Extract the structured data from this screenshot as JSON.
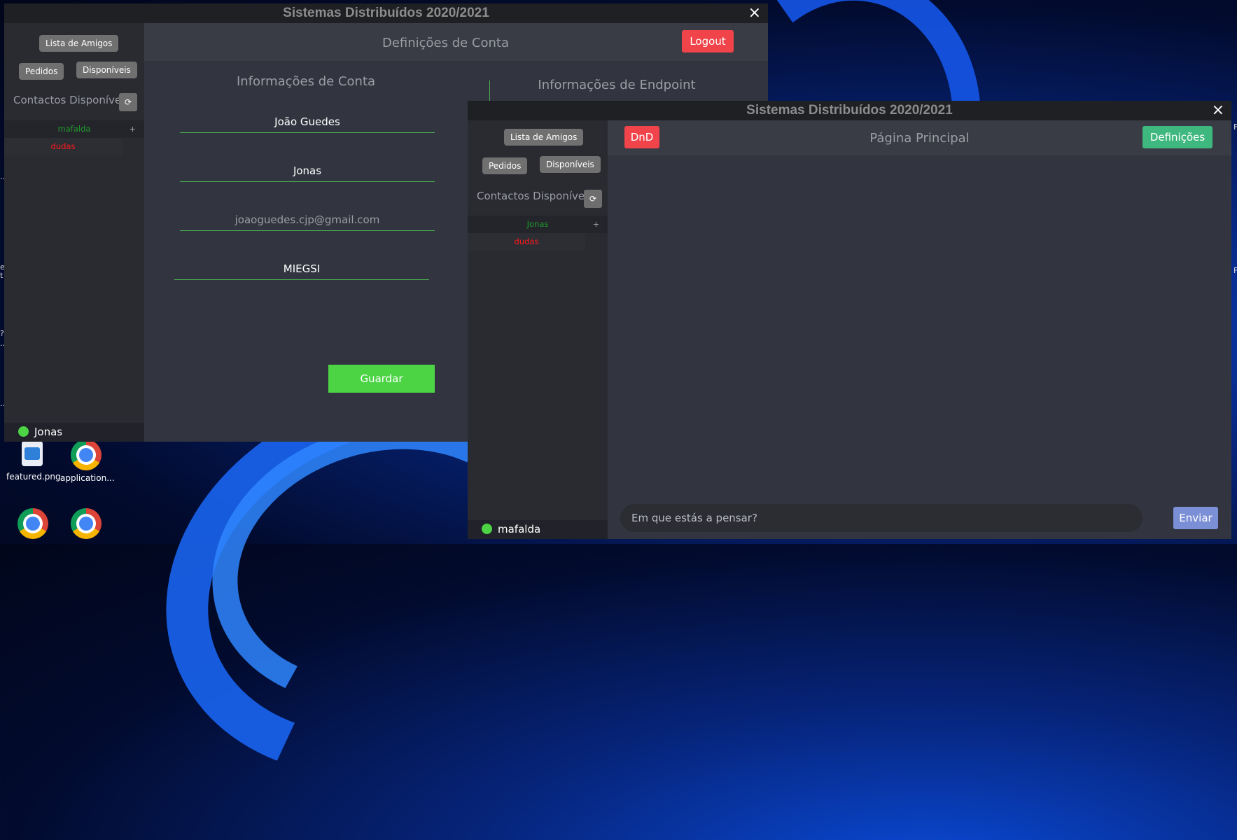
{
  "desktop": {
    "icons": [
      {
        "label": "featured.png",
        "kind": "image"
      },
      {
        "label": "application...",
        "kind": "chrome"
      },
      {
        "label": "",
        "kind": "chrome"
      },
      {
        "label": "",
        "kind": "chrome"
      }
    ]
  },
  "window_settings": {
    "title": "Sistemas Distribuídos 2020/2021",
    "close_icon": "×",
    "sidebar": {
      "friends_list": "Lista de Amigos",
      "requests": "Pedidos",
      "available": "Disponíveis",
      "contacts_title": "Contactos Disponíveis",
      "refresh_icon": "⟳",
      "contacts": [
        {
          "name": "mafalda",
          "color": "#1f9a2a",
          "action": "+"
        },
        {
          "name": "dudas",
          "color": "#ff1a1a",
          "action": ""
        }
      ],
      "status_user": "Jonas"
    },
    "header": {
      "title": "Definições de Conta",
      "logout": "Logout"
    },
    "account_section": {
      "title": "Informações de Conta",
      "name": "João Guedes",
      "username": "Jonas",
      "email_placeholder": "joaoguedes.cjp@gmail.com",
      "course": "MIEGSI",
      "save": "Guardar"
    },
    "endpoint_section": {
      "title": "Informações de Endpoint"
    }
  },
  "window_main": {
    "title": "Sistemas Distribuídos 2020/2021",
    "close_icon": "×",
    "sidebar": {
      "friends_list": "Lista de Amigos",
      "requests": "Pedidos",
      "available": "Disponíveis",
      "contacts_title": "Contactos Disponíveis",
      "refresh_icon": "⟳",
      "contacts": [
        {
          "name": "Jonas",
          "color": "#1f9a2a",
          "action": "+"
        },
        {
          "name": "dudas",
          "color": "#ff1a1a",
          "action": ""
        }
      ],
      "status_user": "mafalda"
    },
    "header": {
      "dnd": "DnD",
      "title": "Página Principal",
      "settings": "Definições"
    },
    "composer": {
      "placeholder": "Em que estás a pensar?",
      "send": "Enviar"
    }
  },
  "colors": {
    "red_button": "#f0444a",
    "green_save": "#4cd445",
    "green_settings": "#3fb87f",
    "send_button": "#7b8fd6",
    "status_online": "#4cd445"
  }
}
